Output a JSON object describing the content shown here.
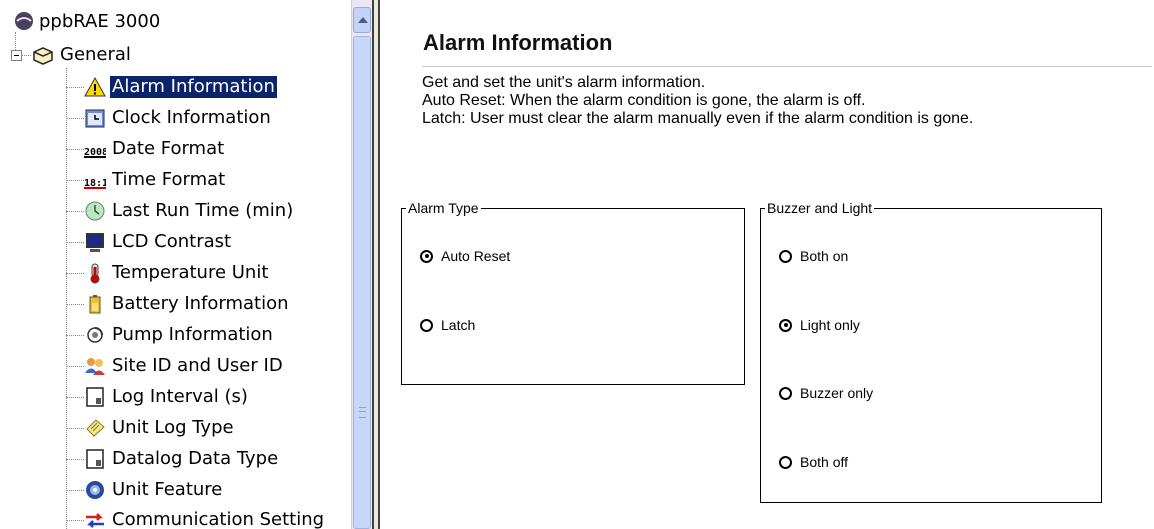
{
  "tree": {
    "root_label": "ppbRAE 3000",
    "general_label": "General",
    "items": [
      {
        "label": "Alarm Information",
        "icon": "warning-icon",
        "selected": true
      },
      {
        "label": "Clock Information",
        "icon": "clock-icon"
      },
      {
        "label": "Date Format",
        "icon": "date-format-icon"
      },
      {
        "label": "Time Format",
        "icon": "time-format-icon"
      },
      {
        "label": "Last Run Time (min)",
        "icon": "timer-icon"
      },
      {
        "label": "LCD Contrast",
        "icon": "monitor-icon"
      },
      {
        "label": "Temperature Unit",
        "icon": "thermometer-icon"
      },
      {
        "label": "Battery Information",
        "icon": "battery-icon"
      },
      {
        "label": "Pump Information",
        "icon": "pump-icon"
      },
      {
        "label": "Site ID and User ID",
        "icon": "users-icon"
      },
      {
        "label": "Log Interval (s)",
        "icon": "document-icon"
      },
      {
        "label": "Unit Log Type",
        "icon": "log-type-icon"
      },
      {
        "label": "Datalog Data Type",
        "icon": "document-icon"
      },
      {
        "label": "Unit Feature",
        "icon": "feature-icon"
      },
      {
        "label": "Communication Setting",
        "icon": "transfer-arrows-icon"
      }
    ]
  },
  "main": {
    "title": "Alarm Information",
    "description": [
      "Get and set the unit's alarm information.",
      "Auto Reset: When the alarm condition is gone, the alarm is off.",
      "Latch: User must clear the alarm manually even if the alarm condition is gone."
    ],
    "alarm_type": {
      "legend": "Alarm Type",
      "options": [
        {
          "label": "Auto Reset",
          "checked": true
        },
        {
          "label": "Latch",
          "checked": false
        }
      ]
    },
    "buzzer_light": {
      "legend": "Buzzer and Light",
      "options": [
        {
          "label": "Both on",
          "checked": false
        },
        {
          "label": "Light only",
          "checked": true
        },
        {
          "label": "Buzzer only",
          "checked": false
        },
        {
          "label": "Both off",
          "checked": false
        }
      ]
    }
  },
  "colors": {
    "selection": "#0a246a",
    "scrollbar": "#c8d6f8"
  }
}
